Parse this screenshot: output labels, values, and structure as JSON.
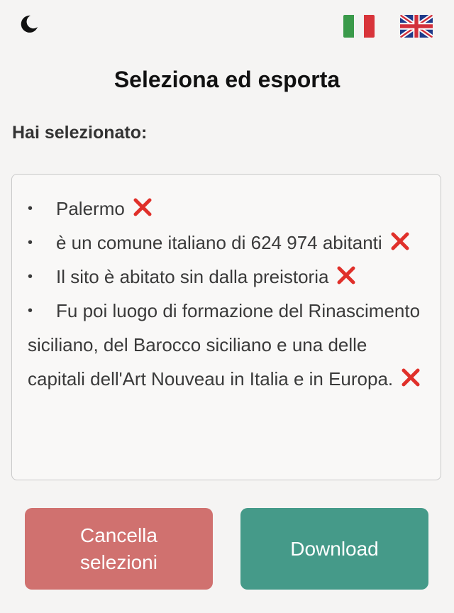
{
  "header": {
    "theme_toggle_icon": "moon-icon",
    "lang_it_icon": "italian-flag-icon",
    "lang_en_icon": "uk-flag-icon"
  },
  "title": "Seleziona ed esporta",
  "subtitle": "Hai selezionato:",
  "selections": [
    {
      "text": "Palermo"
    },
    {
      "text": "è un comune italiano di 624 974 abitanti"
    },
    {
      "text": "Il sito è abitato sin dalla preistoria"
    },
    {
      "text": "Fu poi luogo di formazione del Rinascimento siciliano, del Barocco siciliano e una delle capitali dell'Art Nouveau in Italia e in Europa."
    }
  ],
  "buttons": {
    "cancel_label_line1": "Cancella",
    "cancel_label_line2": "selezioni",
    "download_label": "Download"
  },
  "colors": {
    "cancel": "#d0716f",
    "download": "#459a89",
    "remove_icon": "#e0302a"
  }
}
